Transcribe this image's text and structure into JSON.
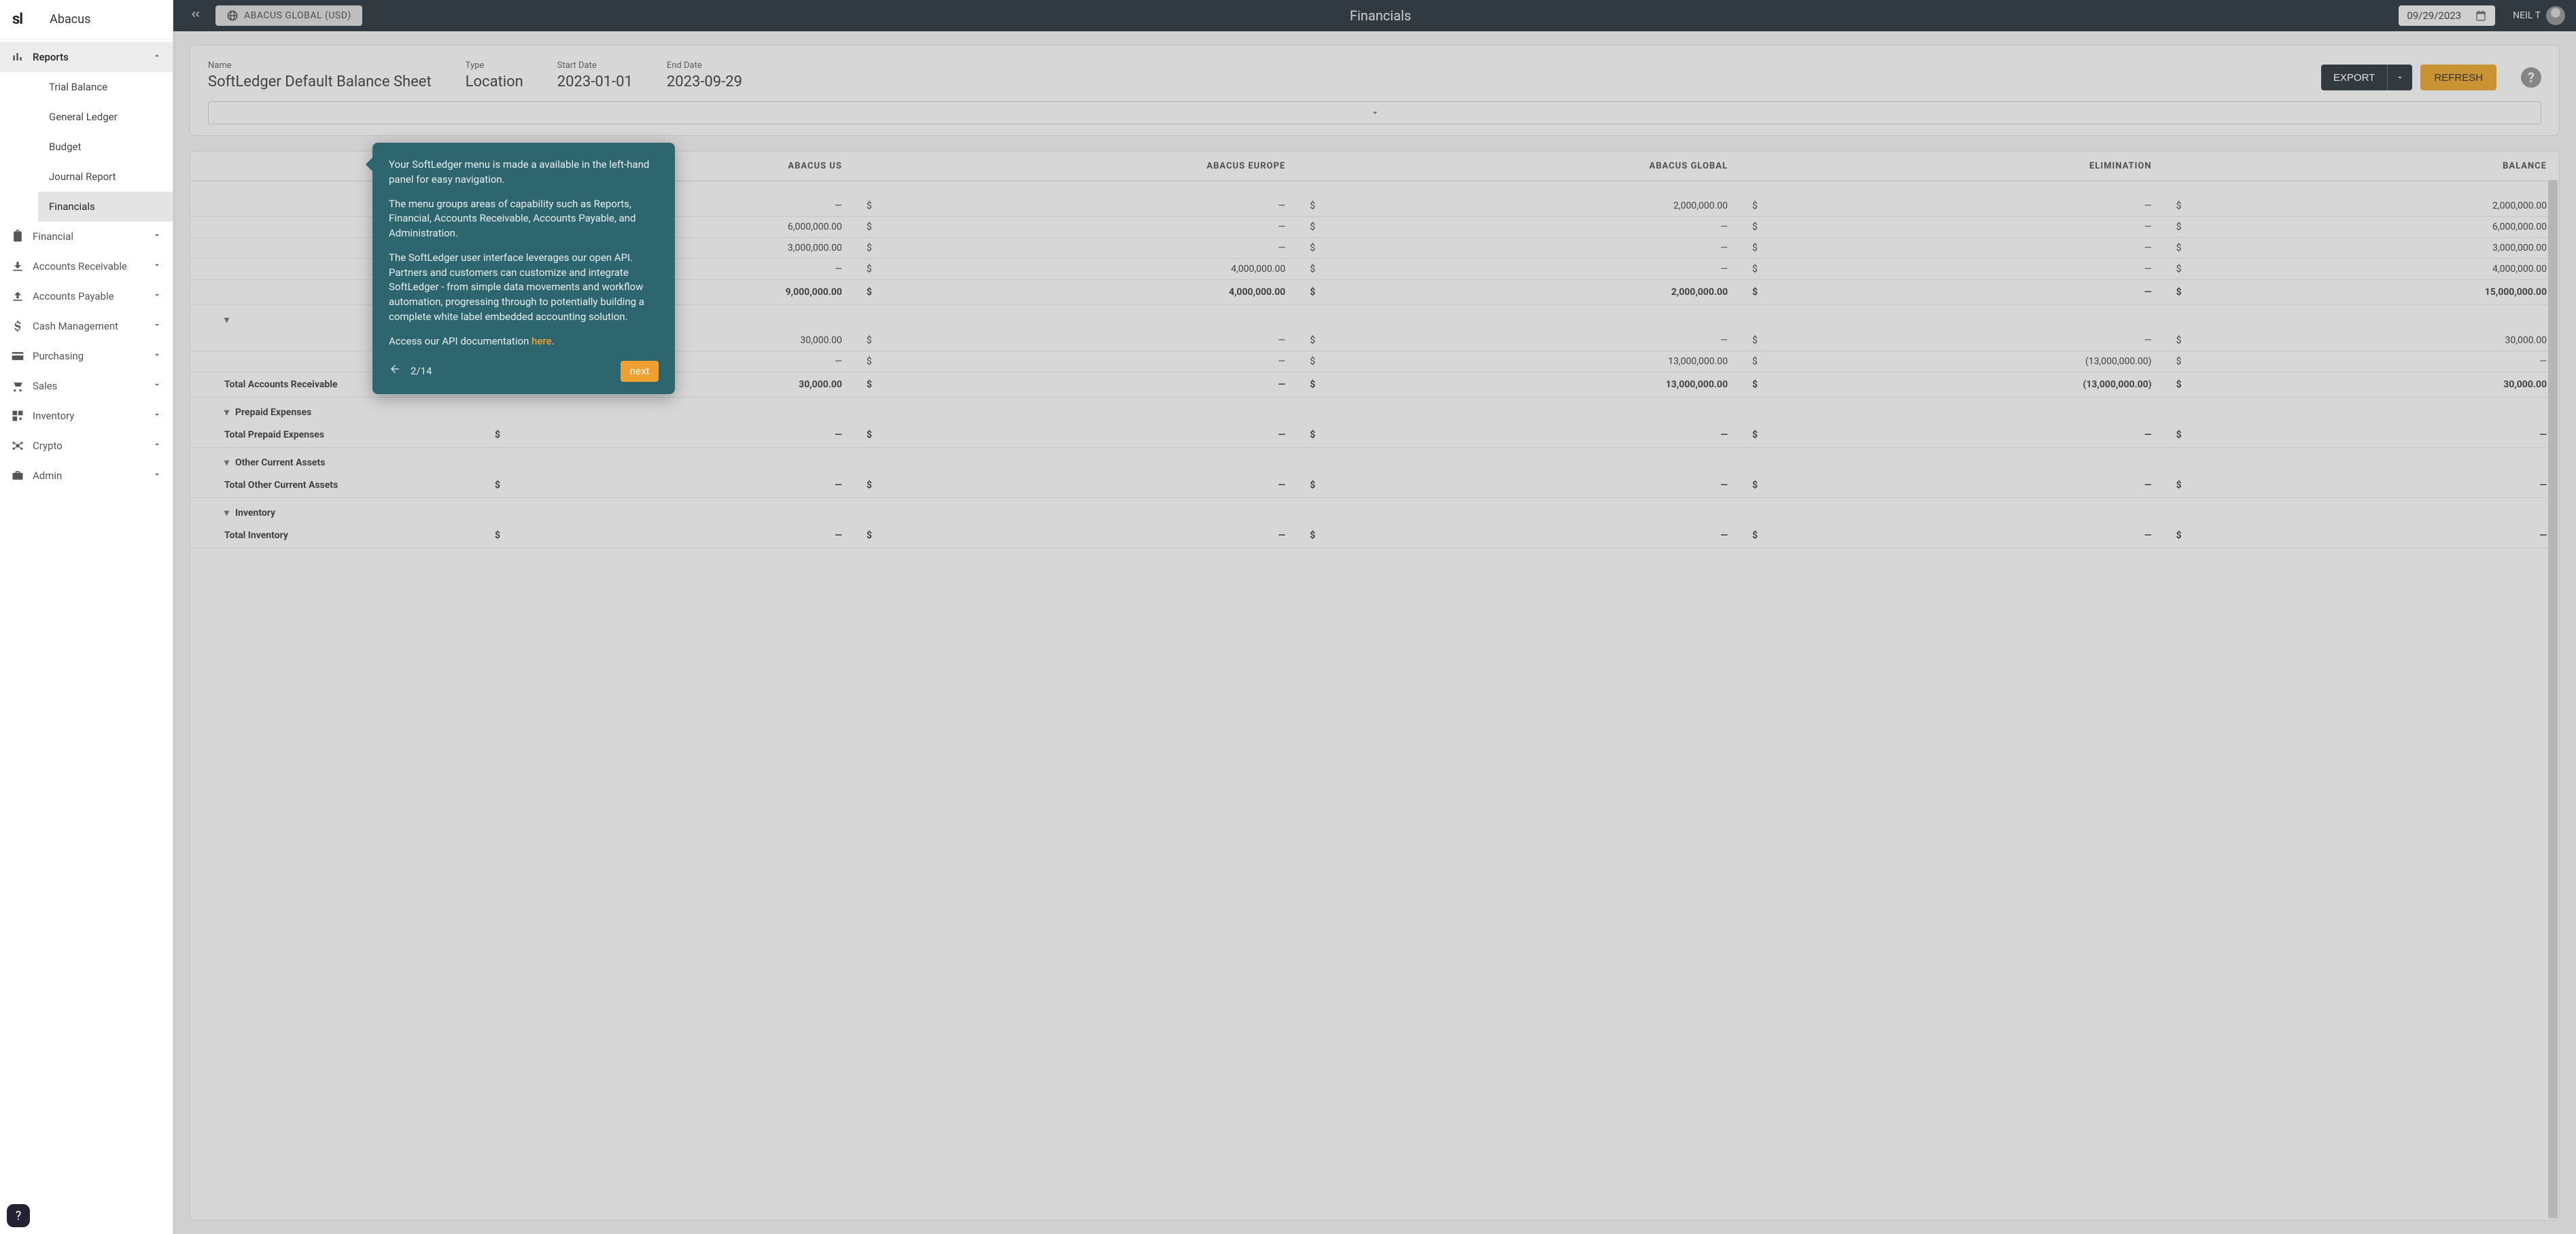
{
  "brand": {
    "logo": "sl",
    "name": "Abacus"
  },
  "sidebar": {
    "reports_label": "Reports",
    "reports_children": [
      {
        "label": "Trial Balance"
      },
      {
        "label": "General Ledger"
      },
      {
        "label": "Budget"
      },
      {
        "label": "Journal Report"
      },
      {
        "label": "Financials"
      }
    ],
    "items": [
      {
        "label": "Financial"
      },
      {
        "label": "Accounts Receivable"
      },
      {
        "label": "Accounts Payable"
      },
      {
        "label": "Cash Management"
      },
      {
        "label": "Purchasing"
      },
      {
        "label": "Sales"
      },
      {
        "label": "Inventory"
      },
      {
        "label": "Crypto"
      },
      {
        "label": "Admin"
      }
    ]
  },
  "topbar": {
    "entity": "ABACUS GLOBAL (USD)",
    "title": "Financials",
    "date": "09/29/2023",
    "user": "NEIL T"
  },
  "report": {
    "name_label": "Name",
    "name_value": "SoftLedger Default Balance Sheet",
    "type_label": "Type",
    "type_value": "Location",
    "start_label": "Start Date",
    "start_value": "2023-01-01",
    "end_label": "End Date",
    "end_value": "2023-09-29",
    "export_label": "EXPORT",
    "refresh_label": "REFRESH"
  },
  "table": {
    "headers": [
      "",
      "ABACUS US",
      "ABACUS EUROPE",
      "ABACUS GLOBAL",
      "ELIMINATION",
      "BALANCE"
    ],
    "rows": [
      {
        "kind": "section",
        "indent": 0,
        "label": "",
        "cells": [
          "",
          "",
          "",
          "",
          ""
        ]
      },
      {
        "kind": "detail",
        "indent": 3,
        "label": "",
        "cells": [
          "—",
          "—",
          "2,000,000.00",
          "—",
          "2,000,000.00"
        ]
      },
      {
        "kind": "detail",
        "indent": 3,
        "label": "",
        "cells": [
          "6,000,000.00",
          "—",
          "—",
          "—",
          "6,000,000.00"
        ]
      },
      {
        "kind": "detail",
        "indent": 3,
        "label": "",
        "cells": [
          "3,000,000.00",
          "—",
          "—",
          "—",
          "3,000,000.00"
        ]
      },
      {
        "kind": "detail",
        "indent": 3,
        "label": "",
        "cells": [
          "—",
          "4,000,000.00",
          "—",
          "—",
          "4,000,000.00"
        ]
      },
      {
        "kind": "group",
        "indent": 2,
        "label": "",
        "cells": [
          "9,000,000.00",
          "4,000,000.00",
          "2,000,000.00",
          "—",
          "15,000,000.00"
        ]
      },
      {
        "kind": "section",
        "indent": 2,
        "chev": true,
        "label": "",
        "cells": [
          "",
          "",
          "",
          "",
          ""
        ]
      },
      {
        "kind": "detail",
        "indent": 3,
        "label": "",
        "cells": [
          "30,000.00",
          "—",
          "—",
          "—",
          "30,000.00"
        ]
      },
      {
        "kind": "detail",
        "indent": 3,
        "label": "",
        "cells": [
          "—",
          "—",
          "13,000,000.00",
          "(13,000,000.00)",
          "—"
        ]
      },
      {
        "kind": "group",
        "indent": 2,
        "label": "Total Accounts Receivable",
        "cells": [
          "30,000.00",
          "—",
          "13,000,000.00",
          "(13,000,000.00)",
          "30,000.00"
        ]
      },
      {
        "kind": "section",
        "indent": 2,
        "chev": true,
        "label": "Prepaid Expenses",
        "cells": [
          "",
          "",
          "",
          "",
          ""
        ]
      },
      {
        "kind": "group",
        "indent": 2,
        "label": "Total Prepaid Expenses",
        "cells": [
          "—",
          "—",
          "—",
          "—",
          "—"
        ]
      },
      {
        "kind": "section",
        "indent": 2,
        "chev": true,
        "label": "Other Current Assets",
        "cells": [
          "",
          "",
          "",
          "",
          ""
        ]
      },
      {
        "kind": "group",
        "indent": 2,
        "label": "Total Other Current Assets",
        "cells": [
          "—",
          "—",
          "—",
          "—",
          "—"
        ]
      },
      {
        "kind": "section",
        "indent": 2,
        "chev": true,
        "label": "Inventory",
        "cells": [
          "",
          "",
          "",
          "",
          ""
        ]
      },
      {
        "kind": "group",
        "indent": 2,
        "label": "Total Inventory",
        "cells": [
          "—",
          "—",
          "—",
          "—",
          "—"
        ]
      }
    ]
  },
  "tour": {
    "p1": "Your SoftLedger menu is made a available in the left-hand panel for easy navigation.",
    "p2": "The menu groups areas of capability such as Reports, Financial, Accounts Receivable, Accounts Payable, and Administration.",
    "p3": "The SoftLedger user interface leverages our open API. Partners and customers can customize and integrate SoftLedger - from simple data movements and workflow automation, progressing through to potentially building a complete white label embedded accounting solution.",
    "p4_prefix": "Access our API documentation ",
    "p4_link": "here",
    "step": "2/14",
    "next": "next"
  }
}
